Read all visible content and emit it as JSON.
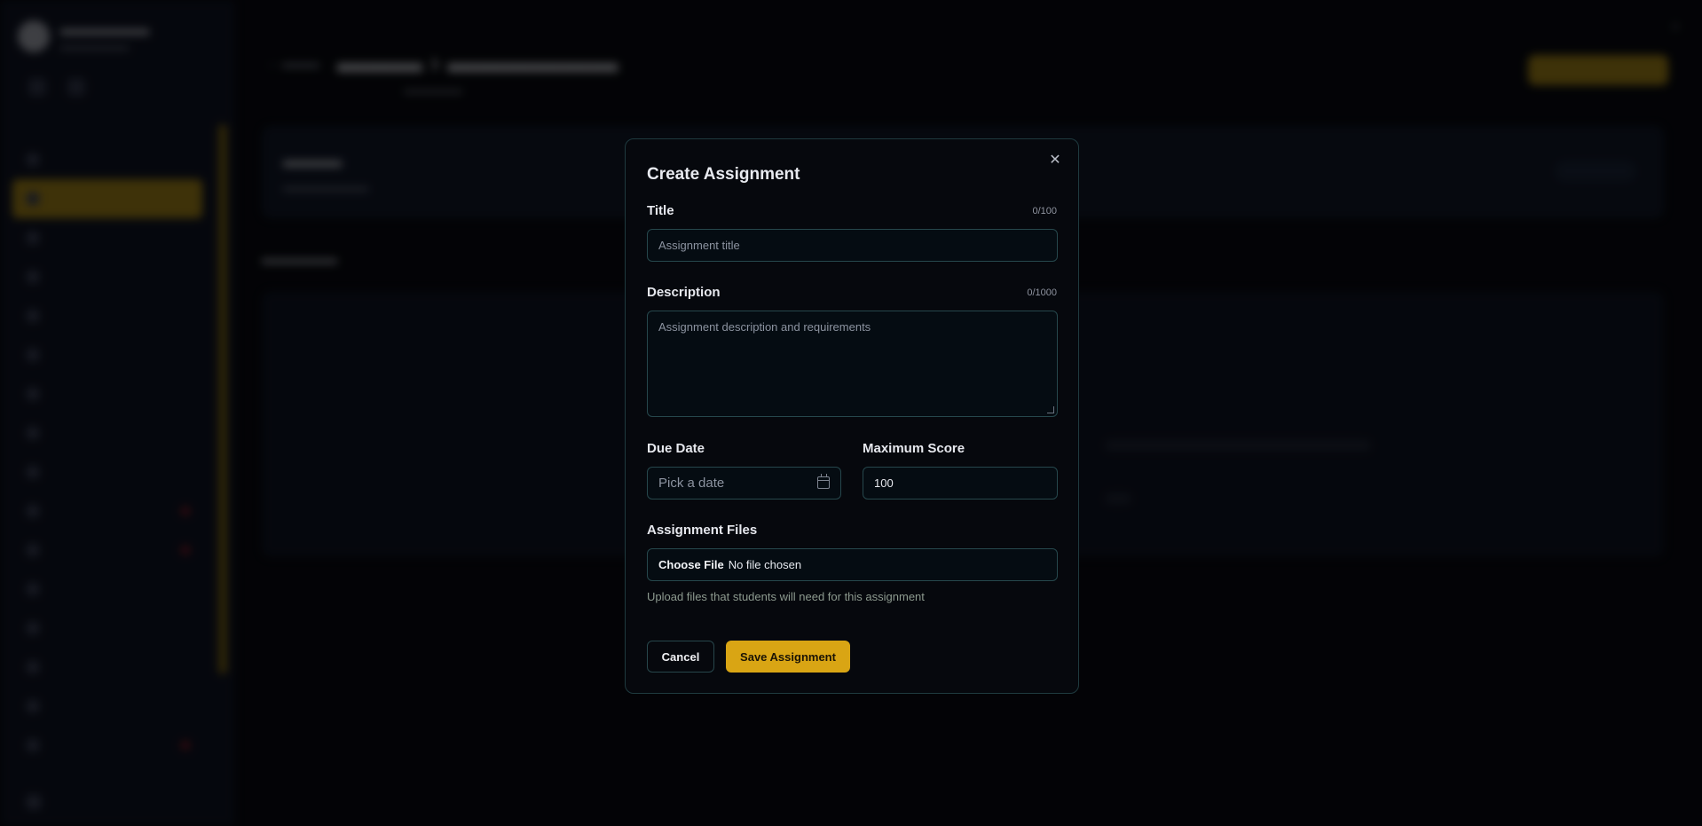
{
  "dialog": {
    "title": "Create Assignment",
    "close_icon": "close-icon",
    "title_field": {
      "label": "Title",
      "counter": "0/100",
      "placeholder": "Assignment title"
    },
    "description_field": {
      "label": "Description",
      "counter": "0/1000",
      "placeholder": "Assignment description and requirements"
    },
    "due_date": {
      "label": "Due Date",
      "placeholder": "Pick a date",
      "icon": "calendar-icon"
    },
    "max_score": {
      "label": "Maximum Score",
      "value": "100"
    },
    "files": {
      "label": "Assignment Files",
      "button": "Choose File",
      "status": "No file chosen",
      "hint": "Upload files that students will need for this assignment"
    },
    "cancel_label": "Cancel",
    "save_label": "Save Assignment"
  },
  "colors": {
    "accent": "#d9a514",
    "dialog_bg": "#06080d",
    "border": "#26474c"
  }
}
